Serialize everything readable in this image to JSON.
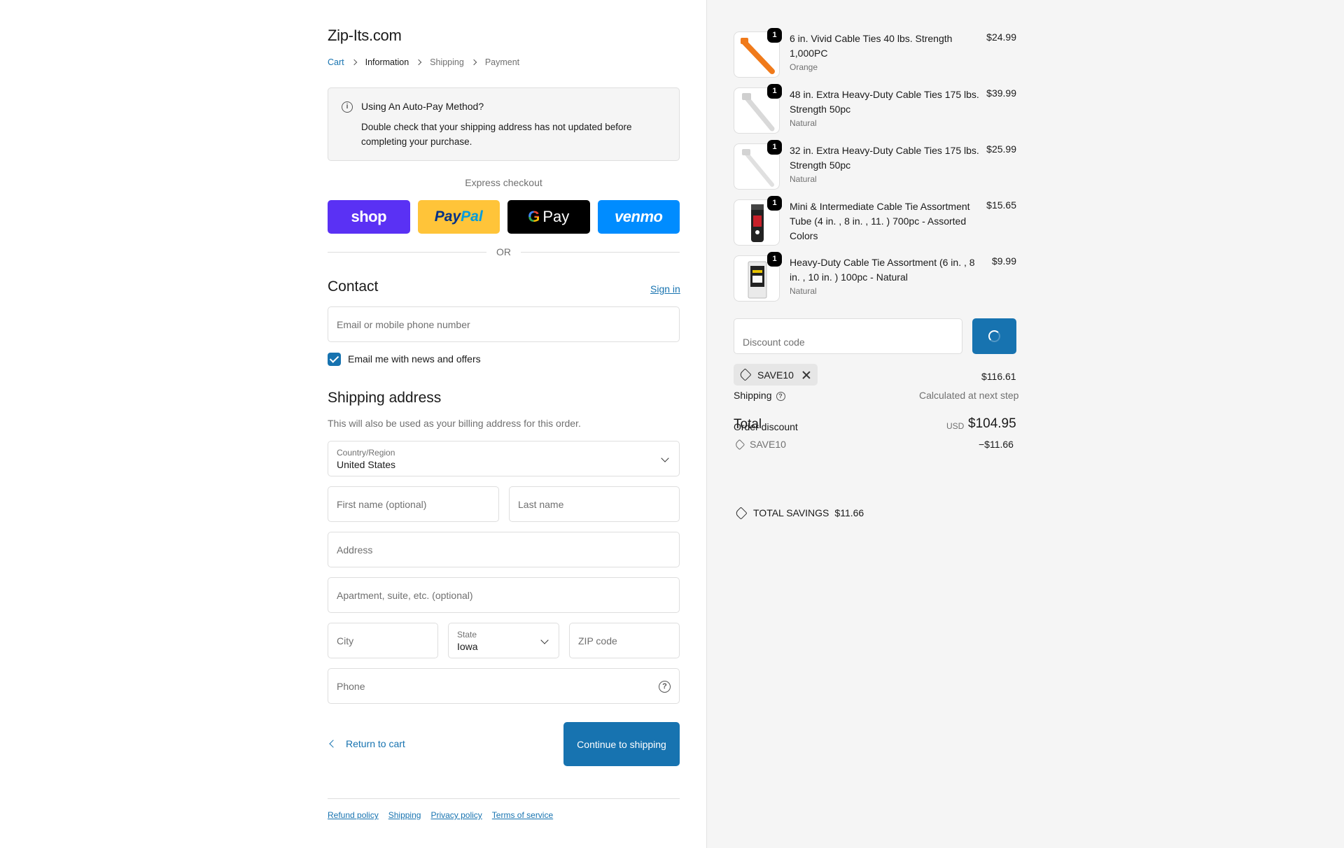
{
  "store": {
    "name": "Zip-Its.com"
  },
  "breadcrumb": [
    {
      "label": "Cart"
    },
    {
      "label": "Information"
    },
    {
      "label": "Shipping"
    },
    {
      "label": "Payment"
    }
  ],
  "notice": {
    "title": "Using An Auto-Pay Method?",
    "body": "Double check that your shipping address has not updated before completing your purchase."
  },
  "express": {
    "label": "Express checkout",
    "buttons": {
      "shop": "shop",
      "paypal_a": "Pay",
      "paypal_b": "Pal",
      "gpay_g": "G",
      "gpay": "Pay",
      "venmo": "venmo"
    },
    "or": "OR"
  },
  "contact": {
    "heading": "Contact",
    "signin": "Sign in",
    "email_placeholder": "Email or mobile phone number",
    "news_label": "Email me with news and offers",
    "news_checked": true
  },
  "shipping": {
    "heading": "Shipping address",
    "sub": "This will also be used as your billing address for this order.",
    "country_label": "Country/Region",
    "country_value": "United States",
    "first_name_ph": "First name (optional)",
    "last_name_ph": "Last name",
    "address_ph": "Address",
    "apartment_ph": "Apartment, suite, etc. (optional)",
    "city_ph": "City",
    "state_label": "State",
    "state_value": "Iowa",
    "zip_ph": "ZIP code",
    "phone_ph": "Phone"
  },
  "actions": {
    "return": "Return to cart",
    "continue": "Continue to shipping"
  },
  "footer": [
    "Refund policy",
    "Shipping",
    "Privacy policy",
    "Terms of service"
  ],
  "order": {
    "items": [
      {
        "qty": "1",
        "name": "6 in. Vivid Cable Ties 40 lbs. Strength 1,000PC",
        "variant": "Orange",
        "price": "$24.99"
      },
      {
        "qty": "1",
        "name": "48 in. Extra Heavy-Duty Cable Ties 175 lbs. Strength 50pc",
        "variant": "Natural",
        "price": "$39.99"
      },
      {
        "qty": "1",
        "name": "32 in. Extra Heavy-Duty Cable Ties 175 lbs. Strength 50pc",
        "variant": "Natural",
        "price": "$25.99"
      },
      {
        "qty": "1",
        "name": "Mini & Intermediate Cable Tie Assortment Tube (4 in. , 8 in. , 11. ) 700pc - Assorted Colors",
        "variant": "",
        "price": "$15.65"
      },
      {
        "qty": "1",
        "name": "Heavy-Duty Cable Tie Assortment (6 in. , 8 in. , 10 in. ) 100pc - Natural",
        "variant": "Natural",
        "price": "$9.99"
      }
    ],
    "discount_placeholder": "Discount code",
    "applied_code": "SAVE10",
    "subtotal_value": "$116.61",
    "shipping_label": "Shipping",
    "shipping_value": "Calculated at next step",
    "total_label": "Total",
    "order_discount_label": "Order discount",
    "discount_code_line": "SAVE10",
    "discount_value": "−$11.66",
    "currency": "USD",
    "total_value": "$104.95",
    "savings_label": "TOTAL SAVINGS",
    "savings_value": "$11.66"
  }
}
